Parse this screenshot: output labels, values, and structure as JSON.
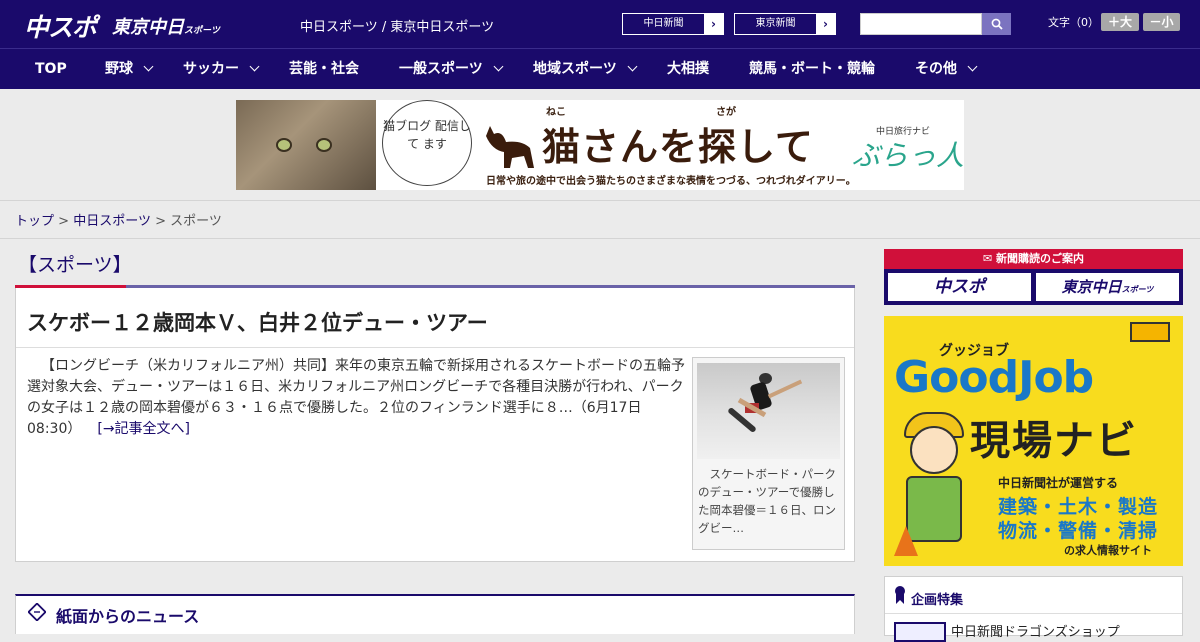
{
  "header": {
    "logo_chunichi_sports": "中スポ",
    "logo_tokyo_chunichi": "東京中日",
    "logo_tokyo_sub": "スポーツ",
    "site_title": "中日スポーツ / 東京中日スポーツ",
    "links": [
      {
        "label": "中日新聞"
      },
      {
        "label": "東京新聞"
      }
    ],
    "search": {
      "placeholder": "",
      "button_icon": "search-icon"
    },
    "font_size_label": "文字（0）",
    "font_bigger": "＋大",
    "font_smaller": "－小"
  },
  "nav": {
    "items": [
      {
        "label": "TOP",
        "dropdown": false
      },
      {
        "label": "野球",
        "dropdown": true
      },
      {
        "label": "サッカー",
        "dropdown": true
      },
      {
        "label": "芸能・社会",
        "dropdown": false
      },
      {
        "label": "一般スポーツ",
        "dropdown": true
      },
      {
        "label": "地域スポーツ",
        "dropdown": true
      },
      {
        "label": "大相撲",
        "dropdown": false
      },
      {
        "label": "競馬・ボート・競輪",
        "dropdown": false
      },
      {
        "label": "その他",
        "dropdown": true
      }
    ]
  },
  "banner": {
    "bubble_text": "猫ブログ 配信して ます",
    "ruby_neko": "ねこ",
    "ruby_saga": "さが",
    "title": "猫さんを探して",
    "brand_small": "中日旅行ナビ",
    "brand": "ぶらっ人",
    "subtitle": "日常や旅の途中で出会う猫たちのさまざまな表情をつづる、つれづれダイアリー。"
  },
  "breadcrumb": {
    "items": [
      "トップ",
      "中日スポーツ",
      "スポーツ"
    ],
    "separator": ">"
  },
  "section": {
    "title": "【スポーツ】"
  },
  "article": {
    "headline": "スケボー１２歳岡本Ｖ、白井２位デュー・ツアー",
    "body": "【ロングビーチ（米カリフォルニア州）共同】来年の東京五輪で新採用されるスケートボードの五輪予選対象大会、デュー・ツアーは１６日、米カリフォルニア州ロングビーチで各種目決勝が行われ、パークの女子は１２歳の岡本碧優が６３・１６点で優勝した。２位のフィンランド選手に８…（6月17日 08:30）",
    "read_more": "[→記事全文へ]",
    "photo_caption": "スケートボード・パークのデュー・ツアーで優勝した岡本碧優＝１６日、ロングビー…"
  },
  "paper_news": {
    "title": "紙面からのニュース"
  },
  "sidebar": {
    "subscribe_header": "新聞購読のご案内",
    "subscribe_buttons": [
      "中スポ",
      "東京中日"
    ],
    "subscribe_small": "スポーツ",
    "ad_goodjob": {
      "kana": "グッジョブ",
      "logo": "GoodJob",
      "navi": "現場ナビ",
      "line1": "中日新聞社が運営する",
      "line2": "建築・土木・製造",
      "line3": "物流・警備・清掃",
      "line4": "の求人情報サイト"
    },
    "kikaku": {
      "title": "企画特集",
      "first_item": "中日新聞ドラゴンズショップ"
    }
  },
  "colors": {
    "primary": "#1a0a6b",
    "accent_red": "#d0103a",
    "accent_purple": "#6a62a8",
    "ad_yellow": "#f8dc1e",
    "ad_blue": "#1a78c8"
  }
}
